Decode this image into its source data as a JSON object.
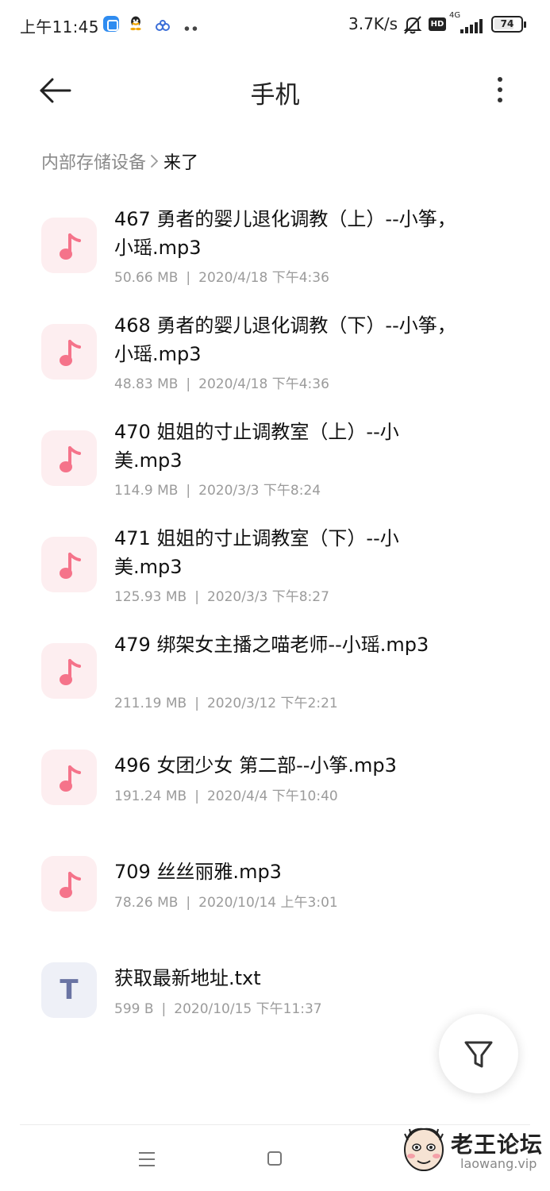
{
  "status_bar": {
    "time": "上午11:45",
    "speed": "3.7K/s",
    "hd": "HD",
    "network": "4G",
    "battery": "74",
    "battery_level": 0.74
  },
  "header": {
    "title": "手机"
  },
  "breadcrumb": {
    "root": "内部存储设备",
    "current": "来了"
  },
  "files": [
    {
      "type": "audio",
      "name": "467 勇者的婴儿退化调教（上）--小筝，小瑶.mp3",
      "size": "50.66 MB",
      "date": "2020/4/18 下午4:36"
    },
    {
      "type": "audio",
      "name": "468 勇者的婴儿退化调教（下）--小筝，小瑶.mp3",
      "size": "48.83 MB",
      "date": "2020/4/18 下午4:36"
    },
    {
      "type": "audio",
      "name": "470 姐姐的寸止调教室（上）--小美.mp3",
      "size": "114.9 MB",
      "date": "2020/3/3 下午8:24"
    },
    {
      "type": "audio",
      "name": "471 姐姐的寸止调教室（下）--小美.mp3",
      "size": "125.93 MB",
      "date": "2020/3/3 下午8:27"
    },
    {
      "type": "audio",
      "name": "479 绑架女主播之喵老师--小瑶.mp3",
      "size": "211.19 MB",
      "date": "2020/3/12 下午2:21"
    },
    {
      "type": "audio",
      "name": "496 女团少女 第二部--小筝.mp3",
      "size": "191.24 MB",
      "date": "2020/4/4 下午10:40"
    },
    {
      "type": "audio",
      "name": "709 丝丝丽雅.mp3",
      "size": "78.26 MB",
      "date": "2020/10/14 上午3:01"
    },
    {
      "type": "text",
      "name": "获取最新地址.txt",
      "size": "599 B",
      "date": "2020/10/15 下午11:37",
      "icon_letter": "T"
    }
  ],
  "meta_separator": "|",
  "icons": {
    "back": "arrow-left-icon",
    "more": "more-vertical-icon",
    "audio": "music-note-icon",
    "text": "text-file-icon",
    "filter": "filter-icon",
    "nav_menu": "menu-icon",
    "nav_home": "home-icon"
  },
  "colors": {
    "audio_icon_bg": "#fdeef0",
    "audio_icon_fg": "#f5738a",
    "text_icon_bg": "#eef0f7",
    "text_icon_fg": "#6a74a3",
    "meta_text": "#9b9b9b"
  },
  "watermark": {
    "title": "老王论坛",
    "url": "laowang.vip"
  }
}
